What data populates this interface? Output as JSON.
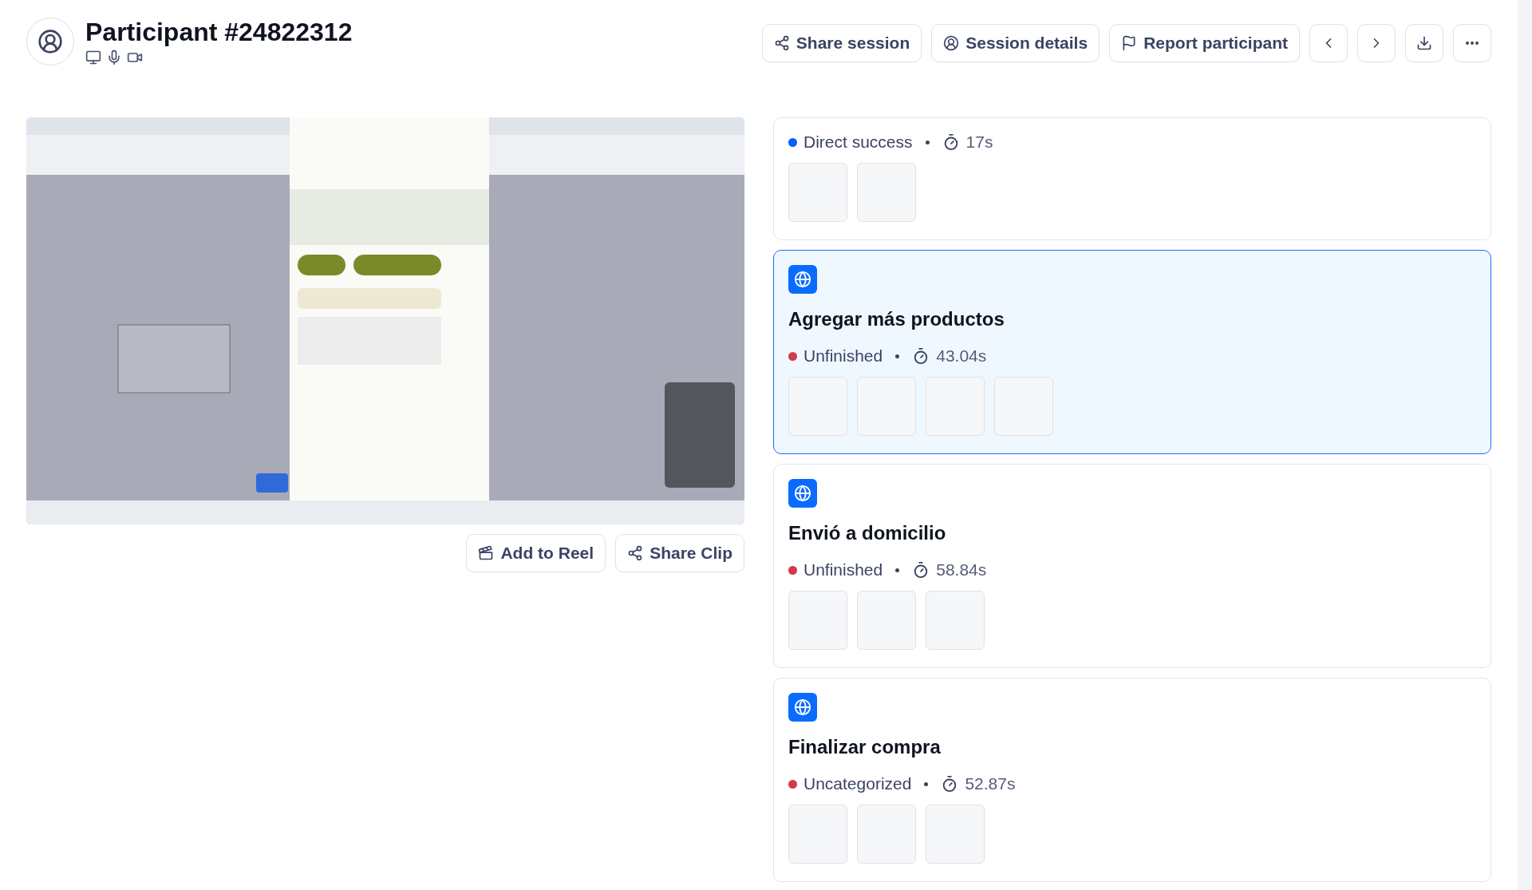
{
  "header": {
    "title": "Participant #24822312",
    "actions": [
      {
        "kind": "share",
        "label": "Share session"
      },
      {
        "kind": "details",
        "label": "Session details"
      },
      {
        "kind": "report",
        "label": "Report participant"
      },
      {
        "kind": "prev"
      },
      {
        "kind": "next"
      },
      {
        "kind": "download"
      },
      {
        "kind": "more"
      }
    ]
  },
  "video": {
    "kind": "picture",
    "actions": [
      {
        "kind": "reel",
        "label": "Add to Reel"
      },
      {
        "kind": "share",
        "label": "Share Clip"
      }
    ]
  },
  "tasks": [
    {
      "status": "Direct success",
      "color": "#0a5cff",
      "time": "17s",
      "thumbnails": [
        {
          "kind": "blank"
        },
        {
          "kind": "blank"
        }
      ],
      "selected": false
    },
    {
      "title": "Agregar más productos",
      "status": "Unfinished",
      "color": "#d13a4a",
      "time": "43.04s",
      "thumbnails": [
        {
          "kind": "blank"
        },
        {
          "kind": "blank"
        },
        {
          "kind": "blank"
        },
        {
          "kind": "blank"
        }
      ],
      "selected": true
    },
    {
      "title": "Envió a domicilio",
      "status": "Unfinished",
      "color": "#d13a4a",
      "time": "58.84s",
      "thumbnails": [
        {
          "kind": "blank"
        },
        {
          "kind": "blank"
        },
        {
          "kind": "blank"
        }
      ],
      "selected": false
    },
    {
      "title": "Finalizar compra",
      "status": "Uncategorized",
      "color": "#d13a4a",
      "time": "52.87s",
      "thumbnails": [
        {
          "kind": "blank"
        },
        {
          "kind": "blank"
        },
        {
          "kind": "blank"
        }
      ],
      "selected": false
    }
  ]
}
